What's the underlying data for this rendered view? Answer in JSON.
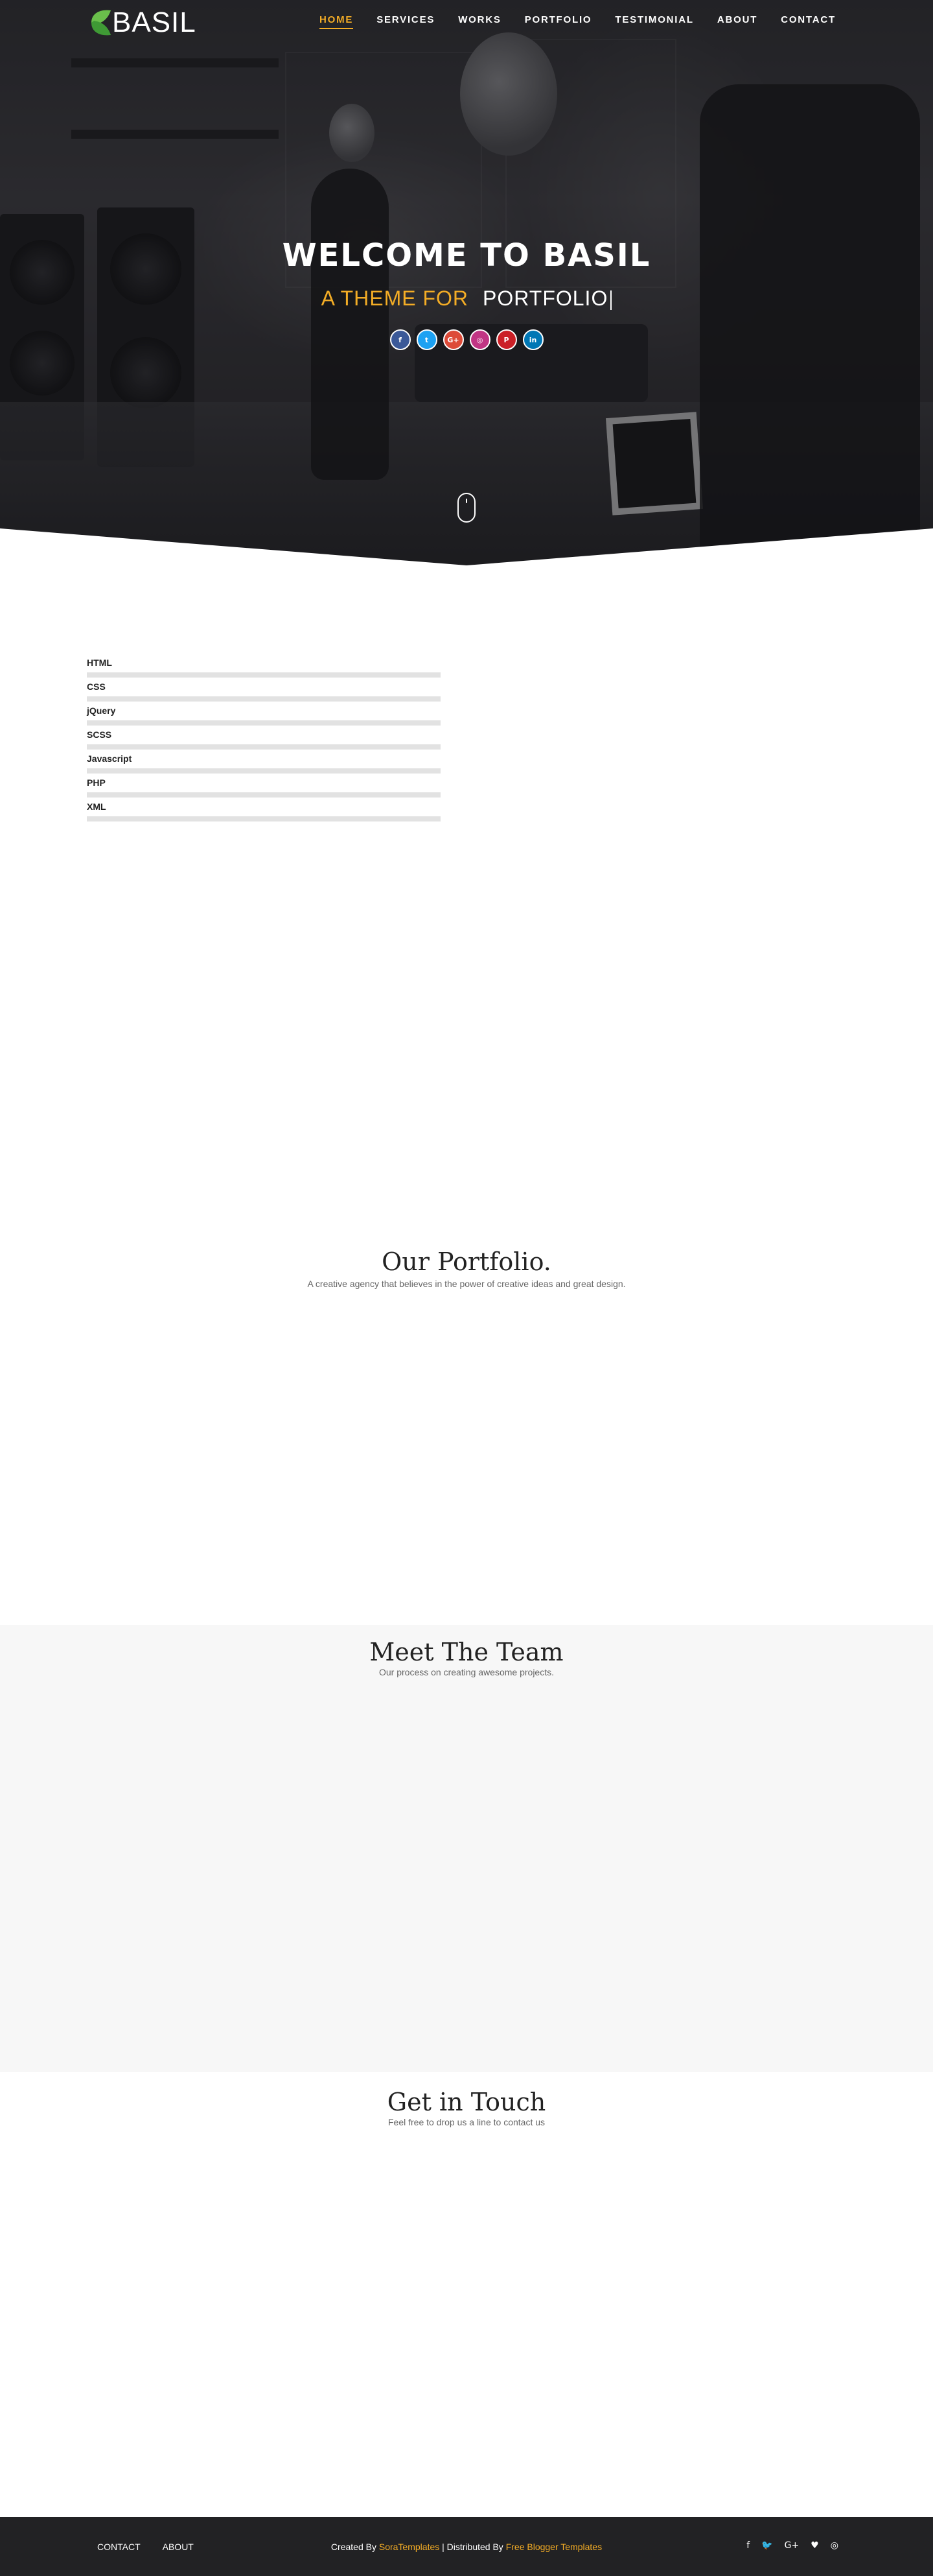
{
  "brand": {
    "logo_text": "BASIL",
    "accent": "#f4ad26",
    "logo_green": "#4cae4c"
  },
  "nav": {
    "items": [
      {
        "label": "HOME",
        "active": true
      },
      {
        "label": "SERVICES",
        "active": false
      },
      {
        "label": "WORKS",
        "active": false
      },
      {
        "label": "PORTFOLIO",
        "active": false
      },
      {
        "label": "TESTIMONIAL",
        "active": false
      },
      {
        "label": "ABOUT",
        "active": false
      },
      {
        "label": "CONTACT",
        "active": false
      }
    ]
  },
  "hero": {
    "title": "WELCOME TO BASIL",
    "subtitle_prefix": "A THEME FOR",
    "subtitle_word": "PORTFOLIO",
    "social": [
      {
        "icon": "facebook-icon",
        "glyph": "f",
        "color": "#3b5998"
      },
      {
        "icon": "twitter-icon",
        "glyph": "t",
        "color": "#1da1f2"
      },
      {
        "icon": "google-plus-icon",
        "glyph": "G+",
        "color": "#dd4b39"
      },
      {
        "icon": "instagram-icon",
        "glyph": "◎",
        "color": "#c13584"
      },
      {
        "icon": "pinterest-icon",
        "glyph": "P",
        "color": "#cb2027"
      },
      {
        "icon": "linkedin-icon",
        "glyph": "in",
        "color": "#0077b5"
      }
    ]
  },
  "skills": [
    {
      "name": "HTML",
      "level": 0
    },
    {
      "name": "CSS",
      "level": 0
    },
    {
      "name": "jQuery",
      "level": 0
    },
    {
      "name": "SCSS",
      "level": 0
    },
    {
      "name": "Javascript",
      "level": 0
    },
    {
      "name": "PHP",
      "level": 0
    },
    {
      "name": "XML",
      "level": 0
    }
  ],
  "portfolio": {
    "title": "Our Portfolio.",
    "subtitle": "A creative agency that believes in the power of creative ideas and great design."
  },
  "team": {
    "title": "Meet The Team",
    "subtitle": "Our process on creating awesome projects."
  },
  "contact": {
    "title": "Get in Touch",
    "subtitle": "Feel free to drop us a line to contact us"
  },
  "footer": {
    "links": [
      "CONTACT",
      "ABOUT"
    ],
    "credit_created": "Created By",
    "credit_author": "SoraTemplates",
    "credit_sep": " | Distributed By",
    "credit_distributor": "Free Blogger Templates",
    "social": [
      {
        "icon": "facebook-icon",
        "glyph": "f"
      },
      {
        "icon": "twitter-icon",
        "glyph": "🐦"
      },
      {
        "icon": "google-plus-icon",
        "glyph": "G+"
      },
      {
        "icon": "heart-icon",
        "glyph": "♥"
      },
      {
        "icon": "instagram-icon",
        "glyph": "◎"
      }
    ]
  }
}
